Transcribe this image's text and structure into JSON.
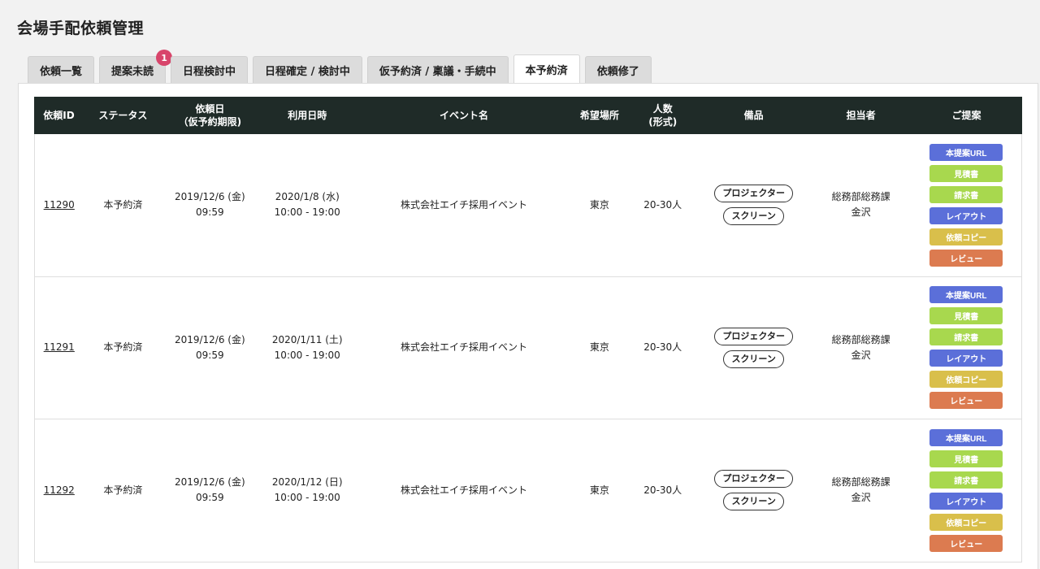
{
  "page": {
    "title": "会場手配依頼管理"
  },
  "tabs": [
    {
      "label": "依頼一覧",
      "active": false,
      "badge": ""
    },
    {
      "label": "提案未読",
      "active": false,
      "badge": "1"
    },
    {
      "label": "日程検討中",
      "active": false,
      "badge": ""
    },
    {
      "label": "日程確定 / 検討中",
      "active": false,
      "badge": ""
    },
    {
      "label": "仮予約済 / 稟議・手続中",
      "active": false,
      "badge": ""
    },
    {
      "label": "本予約済",
      "active": true,
      "badge": ""
    },
    {
      "label": "依頼修了",
      "active": false,
      "badge": ""
    }
  ],
  "table": {
    "headers": {
      "id": "依頼ID",
      "status": "ステータス",
      "request_date_1": "依頼日",
      "request_date_2": "（仮予約期限)",
      "use_datetime": "利用日時",
      "event": "イベント名",
      "place": "希望場所",
      "people_1": "人数",
      "people_2": "(形式)",
      "equipment": "備品",
      "staff": "担当者",
      "proposal": "ご提案"
    },
    "rows": [
      {
        "id": "11290",
        "status": "本予約済",
        "request_date": "2019/12/6 (金)",
        "request_time": "09:59",
        "use_date": "2020/1/8 (水)",
        "use_time": "10:00 - 19:00",
        "event": "株式会社エイチ採用イベント",
        "place": "東京",
        "people": "20-30人",
        "equip1": "プロジェクター",
        "equip2": "スクリーン",
        "staff1": "総務部総務課",
        "staff2": "金沢"
      },
      {
        "id": "11291",
        "status": "本予約済",
        "request_date": "2019/12/6 (金)",
        "request_time": "09:59",
        "use_date": "2020/1/11 (土)",
        "use_time": "10:00 - 19:00",
        "event": "株式会社エイチ採用イベント",
        "place": "東京",
        "people": "20-30人",
        "equip1": "プロジェクター",
        "equip2": "スクリーン",
        "staff1": "総務部総務課",
        "staff2": "金沢"
      },
      {
        "id": "11292",
        "status": "本予約済",
        "request_date": "2019/12/6 (金)",
        "request_time": "09:59",
        "use_date": "2020/1/12 (日)",
        "use_time": "10:00 - 19:00",
        "event": "株式会社エイチ採用イベント",
        "place": "東京",
        "people": "20-30人",
        "equip1": "プロジェクター",
        "equip2": "スクリーン",
        "staff1": "総務部総務課",
        "staff2": "金沢"
      }
    ],
    "proposal_buttons": [
      {
        "label": "本提案URL",
        "color": "#5b6fd9"
      },
      {
        "label": "見積書",
        "color": "#a8d84e"
      },
      {
        "label": "請求書",
        "color": "#a8d84e"
      },
      {
        "label": "レイアウト",
        "color": "#5b6fd9"
      },
      {
        "label": "依頼コピー",
        "color": "#d9bf4b"
      },
      {
        "label": "レビュー",
        "color": "#dc7b50"
      }
    ]
  }
}
